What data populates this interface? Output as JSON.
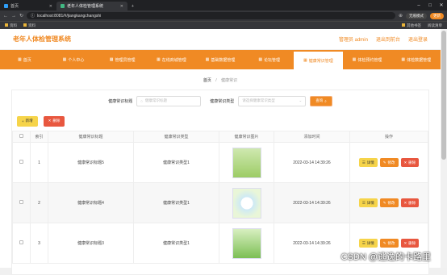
{
  "browser": {
    "tabs": [
      {
        "label": "首页",
        "fav": "#2f9ef7"
      },
      {
        "label": "老年人体检管理系统",
        "fav": "#41b883"
      }
    ],
    "new_tab": "+",
    "url": "localhost:8081/#/jiangkangchangshi",
    "guest_mode": "无痕模式",
    "update": "更新"
  },
  "bookmarks": {
    "left": [
      "资料",
      "资料"
    ],
    "right": [
      "其他书签",
      "阅读清单"
    ]
  },
  "site": {
    "title": "老年人体检管理系统",
    "admin": "管理员 admin",
    "back": "退出到前台",
    "logout": "退出登录"
  },
  "nav": [
    "首页",
    "个人中心",
    "管理员管理",
    "在线商城管理",
    "基础数据管理",
    "论坛管理",
    "健康常识管理",
    "体检预约管理",
    "体检数据管理"
  ],
  "nav_active": 6,
  "breadcrumb": {
    "home": "首页",
    "sep": "/",
    "current": "健康常识"
  },
  "search": {
    "title_label": "健康常识标题",
    "title_placeholder": "健康常识标题",
    "type_label": "健康常识类型",
    "type_placeholder": "请选择健康常识类型",
    "query": "查询"
  },
  "toolbar": {
    "add": "新增",
    "delete": "删除"
  },
  "table": {
    "headers": [
      "",
      "索引",
      "健康常识标题",
      "健康常识类型",
      "健康常识图片",
      "添加时间",
      "操作"
    ],
    "rows": [
      {
        "index": "1",
        "title": "健康常识标题5",
        "type": "健康常识类型1",
        "time": "2022-03-14 14:39:26"
      },
      {
        "index": "2",
        "title": "健康常识标题4",
        "type": "健康常识类型1",
        "time": "2022-03-14 14:39:26"
      },
      {
        "index": "3",
        "title": "健康常识标题3",
        "type": "健康常识类型1",
        "time": "2022-03-14 14:39:26"
      }
    ],
    "actions": {
      "view": "详情",
      "edit": "修改",
      "delete": "删除"
    }
  },
  "watermark": "CSDN @逃逸的卡路里"
}
